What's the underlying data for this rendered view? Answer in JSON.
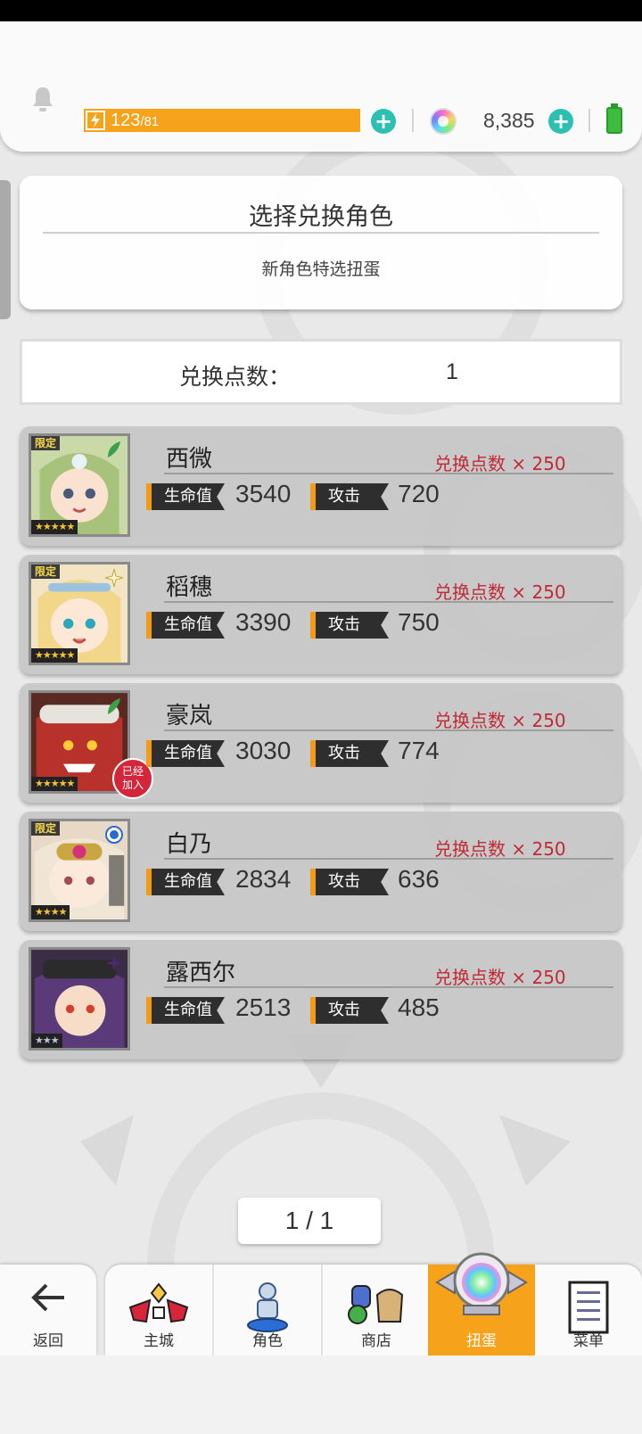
{
  "header": {
    "energy_current": "123",
    "energy_max": "/81",
    "gem_count": "8,385",
    "energy_color": "#f7a21b",
    "plus_color": "#2dbfb1"
  },
  "title_card": {
    "title": "选择兑换角色",
    "subtitle": "新角色特选扭蛋"
  },
  "points": {
    "label": "兑换点数：",
    "value": "1"
  },
  "characters": [
    {
      "name": "西微",
      "cost": "兑换点数 × 250",
      "hp_label": "生命值",
      "hp": "3540",
      "atk_label": "攻击",
      "atk": "720",
      "stars": "★★★★★",
      "limited": "限定",
      "attribute_icon": "leaf-icon"
    },
    {
      "name": "稻穗",
      "cost": "兑换点数 × 250",
      "hp_label": "生命值",
      "hp": "3390",
      "atk_label": "攻击",
      "atk": "750",
      "stars": "★★★★★",
      "limited": "限定",
      "attribute_icon": "sparkle-icon"
    },
    {
      "name": "豪岚",
      "cost": "兑换点数 × 250",
      "hp_label": "生命值",
      "hp": "3030",
      "atk_label": "攻击",
      "atk": "774",
      "stars": "★★★★★",
      "limited": "",
      "attribute_icon": "leaf-icon",
      "joined_badge": "已经加入"
    },
    {
      "name": "白乃",
      "cost": "兑换点数 × 250",
      "hp_label": "生命值",
      "hp": "2834",
      "atk_label": "攻击",
      "atk": "636",
      "stars": "★★★★",
      "limited": "限定",
      "attribute_icon": "water-orb-icon"
    },
    {
      "name": "露西尔",
      "cost": "兑换点数 × 250",
      "hp_label": "生命值",
      "hp": "2513",
      "atk_label": "攻击",
      "atk": "485",
      "stars": "★★★",
      "limited": "",
      "attribute_icon": "dark-star-icon"
    }
  ],
  "pager": {
    "text": "1 / 1"
  },
  "nav": {
    "back": "返回",
    "items": [
      {
        "label": "主城",
        "icon": "castle-icon"
      },
      {
        "label": "角色",
        "icon": "character-icon"
      },
      {
        "label": "商店",
        "icon": "shop-icon"
      },
      {
        "label": "扭蛋",
        "icon": "gacha-icon"
      },
      {
        "label": "菜单",
        "icon": "menu-list-icon"
      }
    ]
  }
}
